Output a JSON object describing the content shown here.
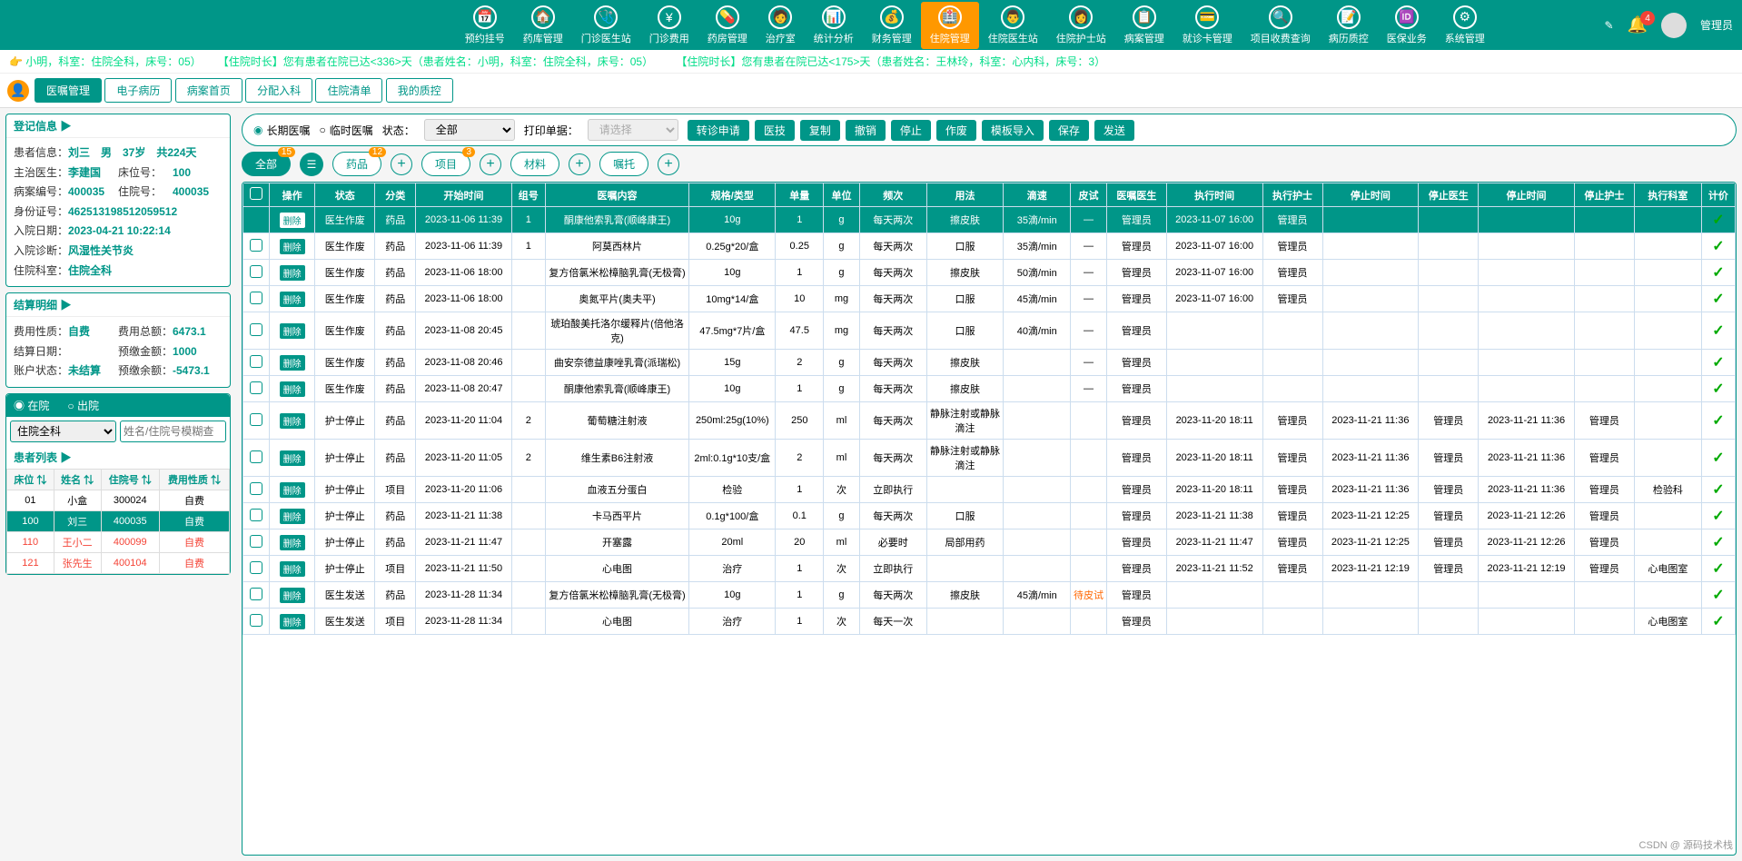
{
  "user": {
    "role": "管理员"
  },
  "nav": [
    {
      "label": "预约挂号",
      "icon": "📅"
    },
    {
      "label": "药库管理",
      "icon": "🏠"
    },
    {
      "label": "门诊医生站",
      "icon": "🩺"
    },
    {
      "label": "门诊费用",
      "icon": "¥"
    },
    {
      "label": "药房管理",
      "icon": "💊"
    },
    {
      "label": "治疗室",
      "icon": "🧑"
    },
    {
      "label": "统计分析",
      "icon": "📊"
    },
    {
      "label": "财务管理",
      "icon": "💰"
    },
    {
      "label": "住院管理",
      "icon": "🏥",
      "active": true
    },
    {
      "label": "住院医生站",
      "icon": "👨"
    },
    {
      "label": "住院护士站",
      "icon": "👩"
    },
    {
      "label": "病案管理",
      "icon": "📋"
    },
    {
      "label": "就诊卡管理",
      "icon": "💳"
    },
    {
      "label": "项目收费查询",
      "icon": "🔍"
    },
    {
      "label": "病历质控",
      "icon": "📝"
    },
    {
      "label": "医保业务",
      "icon": "🆔"
    },
    {
      "label": "系统管理",
      "icon": "⚙"
    }
  ],
  "notif_count": "4",
  "marquee": {
    "p1": "小明，科室：住院全科，床号：05）",
    "p2": "【住院时长】您有患者在院已达<336>天（患者姓名：小明，科室：住院全科，床号：05）",
    "p3": "【住院时长】您有患者在院已达<175>天（患者姓名：王林玲，科室：心内科，床号：3）"
  },
  "tabs": [
    "医嘱管理",
    "电子病历",
    "病案首页",
    "分配入科",
    "住院清单",
    "我的质控"
  ],
  "reg": {
    "title": "登记信息 ▶",
    "patient_lbl": "患者信息：",
    "patient_val": "刘三　男　37岁　共224天",
    "doctor_lbl": "主治医生：",
    "doctor_val": "李建国",
    "bed_lbl": "床位号：",
    "bed_val": "100",
    "caseno_lbl": "病案编号：",
    "caseno_val": "400035",
    "inno_lbl": "住院号：",
    "inno_val": "400035",
    "id_lbl": "身份证号：",
    "id_val": "462513198512059512",
    "date_lbl": "入院日期：",
    "date_val": "2023-04-21 10:22:14",
    "diag_lbl": "入院诊断：",
    "diag_val": "风湿性关节炎",
    "dept_lbl": "住院科室：",
    "dept_val": "住院全科"
  },
  "bill": {
    "title": "结算明细 ▶",
    "t1": "费用性质：",
    "v1": "自费",
    "t2": "费用总额：",
    "v2": "6473.1",
    "t3": "结算日期：",
    "v3": "",
    "t4": "预缴金额：",
    "v4": "1000",
    "t5": "账户状态：",
    "v5": "未结算",
    "t6": "预缴余额：",
    "v6": "-5473.1"
  },
  "filter": {
    "r1": "在院",
    "r2": "出院",
    "dept": "住院全科",
    "ph": "姓名/住院号模糊查"
  },
  "plist": {
    "title": "患者列表 ▶",
    "cols": [
      "床位 ⇅",
      "姓名 ⇅",
      "住院号 ⇅",
      "费用性质 ⇅"
    ],
    "rows": [
      {
        "c": [
          "01",
          "小盒",
          "300024",
          "自费"
        ]
      },
      {
        "c": [
          "100",
          "刘三",
          "400035",
          "自费"
        ],
        "sel": true
      },
      {
        "c": [
          "110",
          "王小二",
          "400099",
          "自费"
        ],
        "red": true
      },
      {
        "c": [
          "121",
          "张先生",
          "400104",
          "自费"
        ],
        "red": true
      }
    ]
  },
  "t1": {
    "r1": "长期医嘱",
    "r2": "临时医嘱",
    "st_lbl": "状态：",
    "st_val": "全部",
    "pr_lbl": "打印单据：",
    "pr_ph": "请选择",
    "btns": [
      "转诊申请",
      "医技",
      "复制",
      "撤销",
      "停止",
      "作废",
      "模板导入",
      "保存",
      "发送"
    ]
  },
  "t2": {
    "pills": [
      {
        "t": "全部",
        "n": "15",
        "active": true
      },
      {
        "t": "药品",
        "n": "12"
      },
      {
        "t": "项目",
        "n": "3"
      },
      {
        "t": "材料"
      },
      {
        "t": "嘱托"
      }
    ]
  },
  "grid": {
    "cols": [
      "",
      "操作",
      "状态",
      "分类",
      "开始时间",
      "组号",
      "医嘱内容",
      "规格/类型",
      "单量",
      "单位",
      "频次",
      "用法",
      "滴速",
      "皮试",
      "医嘱医生",
      "执行时间",
      "执行护士",
      "停止时间",
      "停止医生",
      "停止时间",
      "停止护士",
      "执行科室",
      "计价"
    ],
    "widths": [
      22,
      38,
      50,
      34,
      80,
      28,
      120,
      72,
      40,
      30,
      56,
      64,
      56,
      30,
      50,
      80,
      50,
      80,
      50,
      80,
      50,
      56,
      28
    ],
    "rows": [
      {
        "hl": true,
        "c": [
          "",
          "删除",
          "医生作废",
          "药品",
          "2023-11-06 11:39",
          "1",
          "酮康他索乳膏(顺峰康王)",
          "10g",
          "1",
          "g",
          "每天两次",
          "擦皮肤",
          "35滴/min",
          "—",
          "管理员",
          "2023-11-07 16:00",
          "管理员",
          "",
          "",
          "",
          "",
          "",
          "✓"
        ]
      },
      {
        "c": [
          "",
          "删除",
          "医生作废",
          "药品",
          "2023-11-06 11:39",
          "1",
          "阿莫西林片",
          "0.25g*20/盒",
          "0.25",
          "g",
          "每天两次",
          "口服",
          "35滴/min",
          "—",
          "管理员",
          "2023-11-07 16:00",
          "管理员",
          "",
          "",
          "",
          "",
          "",
          "✓"
        ]
      },
      {
        "c": [
          "",
          "删除",
          "医生作废",
          "药品",
          "2023-11-06 18:00",
          "",
          "复方倍氯米松樟脑乳膏(无极膏)",
          "10g",
          "1",
          "g",
          "每天两次",
          "擦皮肤",
          "50滴/min",
          "—",
          "管理员",
          "2023-11-07 16:00",
          "管理员",
          "",
          "",
          "",
          "",
          "",
          "✓"
        ]
      },
      {
        "c": [
          "",
          "删除",
          "医生作废",
          "药品",
          "2023-11-06 18:00",
          "",
          "奥氮平片(奥夫平)",
          "10mg*14/盒",
          "10",
          "mg",
          "每天两次",
          "口服",
          "45滴/min",
          "—",
          "管理员",
          "2023-11-07 16:00",
          "管理员",
          "",
          "",
          "",
          "",
          "",
          "✓"
        ]
      },
      {
        "c": [
          "",
          "删除",
          "医生作废",
          "药品",
          "2023-11-08 20:45",
          "",
          "琥珀酸美托洛尔缓释片(倍他洛克)",
          "47.5mg*7片/盒",
          "47.5",
          "mg",
          "每天两次",
          "口服",
          "40滴/min",
          "—",
          "管理员",
          "",
          "",
          "",
          "",
          "",
          "",
          "",
          "✓"
        ]
      },
      {
        "c": [
          "",
          "删除",
          "医生作废",
          "药品",
          "2023-11-08 20:46",
          "",
          "曲安奈德益康唑乳膏(派瑞松)",
          "15g",
          "2",
          "g",
          "每天两次",
          "擦皮肤",
          "",
          "—",
          "管理员",
          "",
          "",
          "",
          "",
          "",
          "",
          "",
          "✓"
        ]
      },
      {
        "c": [
          "",
          "删除",
          "医生作废",
          "药品",
          "2023-11-08 20:47",
          "",
          "酮康他索乳膏(顺峰康王)",
          "10g",
          "1",
          "g",
          "每天两次",
          "擦皮肤",
          "",
          "—",
          "管理员",
          "",
          "",
          "",
          "",
          "",
          "",
          "",
          "✓"
        ]
      },
      {
        "c": [
          "",
          "删除",
          "护士停止",
          "药品",
          "2023-11-20 11:04",
          "2",
          "葡萄糖注射液",
          "250ml:25g(10%)",
          "250",
          "ml",
          "每天两次",
          "静脉注射或静脉滴注",
          "",
          "",
          "管理员",
          "2023-11-20 18:11",
          "管理员",
          "2023-11-21 11:36",
          "管理员",
          "2023-11-21 11:36",
          "管理员",
          "",
          "✓"
        ]
      },
      {
        "c": [
          "",
          "删除",
          "护士停止",
          "药品",
          "2023-11-20 11:05",
          "2",
          "维生素B6注射液",
          "2ml:0.1g*10支/盒",
          "2",
          "ml",
          "每天两次",
          "静脉注射或静脉滴注",
          "",
          "",
          "管理员",
          "2023-11-20 18:11",
          "管理员",
          "2023-11-21 11:36",
          "管理员",
          "2023-11-21 11:36",
          "管理员",
          "",
          "✓"
        ]
      },
      {
        "c": [
          "",
          "删除",
          "护士停止",
          "项目",
          "2023-11-20 11:06",
          "",
          "血液五分蛋白",
          "检验",
          "1",
          "次",
          "立即执行",
          "",
          "",
          "",
          "管理员",
          "2023-11-20 18:11",
          "管理员",
          "2023-11-21 11:36",
          "管理员",
          "2023-11-21 11:36",
          "管理员",
          "检验科",
          "✓"
        ]
      },
      {
        "c": [
          "",
          "删除",
          "护士停止",
          "药品",
          "2023-11-21 11:38",
          "",
          "卡马西平片",
          "0.1g*100/盒",
          "0.1",
          "g",
          "每天两次",
          "口服",
          "",
          "",
          "管理员",
          "2023-11-21 11:38",
          "管理员",
          "2023-11-21 12:25",
          "管理员",
          "2023-11-21 12:26",
          "管理员",
          "",
          "✓"
        ]
      },
      {
        "c": [
          "",
          "删除",
          "护士停止",
          "药品",
          "2023-11-21 11:47",
          "",
          "开塞露",
          "20ml",
          "20",
          "ml",
          "必要时",
          "局部用药",
          "",
          "",
          "管理员",
          "2023-11-21 11:47",
          "管理员",
          "2023-11-21 12:25",
          "管理员",
          "2023-11-21 12:26",
          "管理员",
          "",
          "✓"
        ]
      },
      {
        "c": [
          "",
          "删除",
          "护士停止",
          "项目",
          "2023-11-21 11:50",
          "",
          "心电图",
          "治疗",
          "1",
          "次",
          "立即执行",
          "",
          "",
          "",
          "管理员",
          "2023-11-21 11:52",
          "管理员",
          "2023-11-21 12:19",
          "管理员",
          "2023-11-21 12:19",
          "管理员",
          "心电图室",
          "✓"
        ]
      },
      {
        "c": [
          "",
          "删除",
          "医生发送",
          "药品",
          "2023-11-28 11:34",
          "",
          "复方倍氯米松樟脑乳膏(无极膏)",
          "10g",
          "1",
          "g",
          "每天两次",
          "擦皮肤",
          "45滴/min",
          "待皮试",
          "管理员",
          "",
          "",
          "",
          "",
          "",
          "",
          "",
          "✓"
        ],
        "orange": 13
      },
      {
        "c": [
          "",
          "删除",
          "医生发送",
          "项目",
          "2023-11-28 11:34",
          "",
          "心电图",
          "治疗",
          "1",
          "次",
          "每天一次",
          "",
          "",
          "",
          "管理员",
          "",
          "",
          "",
          "",
          "",
          "",
          "心电图室",
          "✓"
        ]
      }
    ]
  },
  "watermark": "CSDN @ 源码技术栈"
}
